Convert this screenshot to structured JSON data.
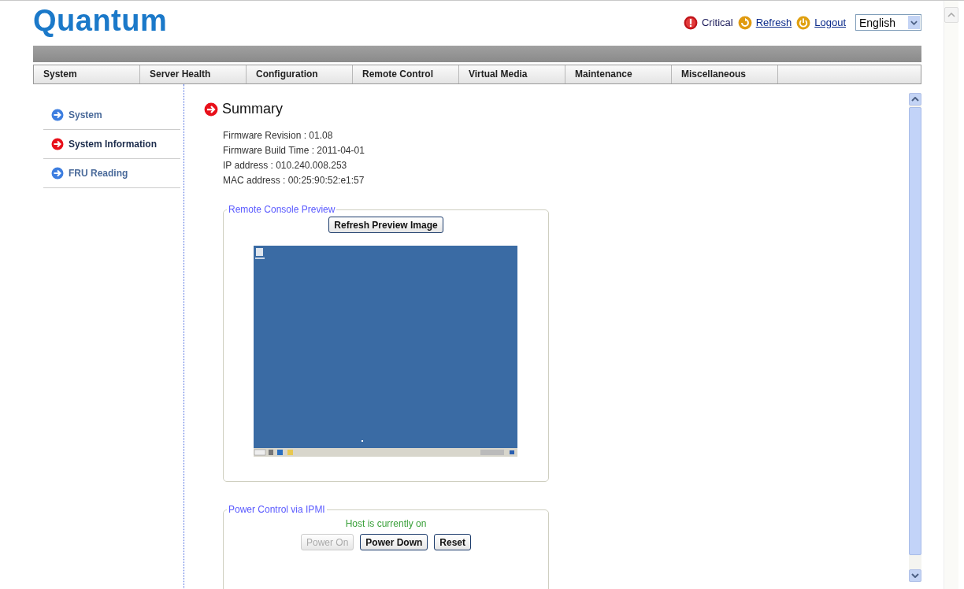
{
  "header": {
    "logo": "Quantum",
    "status": [
      {
        "kind": "alert",
        "label": "Critical"
      },
      {
        "kind": "refresh",
        "label": "Refresh"
      },
      {
        "kind": "logout",
        "label": "Logout"
      }
    ],
    "language": "English"
  },
  "nav": [
    {
      "label": "System"
    },
    {
      "label": "Server Health"
    },
    {
      "label": "Configuration"
    },
    {
      "label": "Remote Control"
    },
    {
      "label": "Virtual Media"
    },
    {
      "label": "Maintenance"
    },
    {
      "label": "Miscellaneous"
    }
  ],
  "sidebar": {
    "items": [
      {
        "label": "System",
        "selected": false
      },
      {
        "label": "System Information",
        "selected": true
      },
      {
        "label": "FRU Reading",
        "selected": false
      }
    ]
  },
  "summary": {
    "title": "Summary",
    "rows": [
      {
        "label": "Firmware Revision :",
        "value": "01.08"
      },
      {
        "label": "Firmware Build Time :",
        "value": "2011-04-01"
      },
      {
        "label": "IP address :",
        "value": "010.240.008.253"
      },
      {
        "label": "MAC address :",
        "value": "00:25:90:52:e1:57"
      }
    ]
  },
  "console_preview": {
    "legend": "Remote Console Preview",
    "button": "Refresh Preview Image"
  },
  "power_control": {
    "legend": "Power Control via IPMI",
    "status": "Host is currently on",
    "buttons": [
      {
        "label": "Power On",
        "disabled": true
      },
      {
        "label": "Power Down",
        "disabled": false
      },
      {
        "label": "Reset",
        "disabled": false
      }
    ]
  }
}
